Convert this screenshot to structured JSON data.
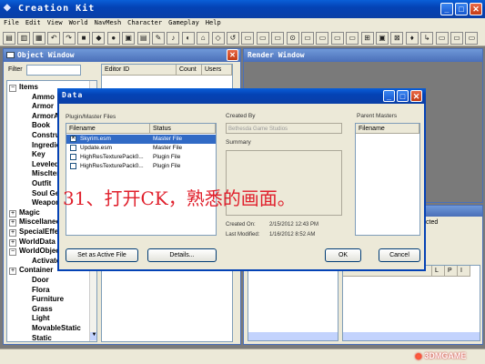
{
  "app": {
    "title": "Creation Kit",
    "menu": [
      "File",
      "Edit",
      "View",
      "World",
      "NavMesh",
      "Character",
      "Gameplay",
      "Help"
    ],
    "colors": {
      "titlebar": "#0442b5",
      "workspace": "#7a7a7a",
      "dialog_bg": "#ece9d8",
      "selection": "#316ac5"
    }
  },
  "object_window": {
    "title": "Object Window",
    "filter_label": "Filter",
    "filter_value": "",
    "columns": [
      "Editor ID",
      "Count",
      "Users"
    ],
    "tree": [
      {
        "label": "Items",
        "expander": "−"
      },
      {
        "label": "Ammo"
      },
      {
        "label": "Armor"
      },
      {
        "label": "ArmorAddon"
      },
      {
        "label": "Book"
      },
      {
        "label": "Constructible"
      },
      {
        "label": "Ingredient"
      },
      {
        "label": "Key"
      },
      {
        "label": "LeveledItem"
      },
      {
        "label": "MiscItem"
      },
      {
        "label": "Outfit"
      },
      {
        "label": "Soul Gem"
      },
      {
        "label": "Weapon"
      },
      {
        "label": "Magic",
        "expander": "+"
      },
      {
        "label": "Miscellaneous",
        "expander": "+"
      },
      {
        "label": "SpecialEffect",
        "expander": "+"
      },
      {
        "label": "WorldData",
        "expander": "+"
      },
      {
        "label": "WorldObjects",
        "expander": "−"
      },
      {
        "label": "Activator"
      },
      {
        "label": "Container",
        "expander": "+"
      },
      {
        "label": "Door"
      },
      {
        "label": "Flora"
      },
      {
        "label": "Furniture"
      },
      {
        "label": "Grass"
      },
      {
        "label": "Light"
      },
      {
        "label": "MovableStatic"
      },
      {
        "label": "Static"
      }
    ]
  },
  "render_window": {
    "title": "Render Window"
  },
  "cell_view": {
    "partial_label": "cted",
    "columns": [
      "L",
      "P",
      "I"
    ]
  },
  "data_dialog": {
    "title": "Data",
    "files_label": "Plugin/Master Files",
    "columns": [
      "Filename",
      "Status"
    ],
    "files": [
      {
        "name": "Skyrim.esm",
        "status": "Master File",
        "checked": true,
        "selected": true
      },
      {
        "name": "Update.esm",
        "status": "Master File",
        "checked": false,
        "selected": false
      },
      {
        "name": "HighResTexturePack0...",
        "status": "Plugin File",
        "checked": false,
        "selected": false
      },
      {
        "name": "HighResTexturePack0...",
        "status": "Plugin File",
        "checked": false,
        "selected": false
      }
    ],
    "created_by_label": "Created By",
    "created_by_value": "Bethesda Game Studios",
    "summary_label": "Summary",
    "parent_masters_label": "Parent Masters",
    "parent_masters_column": "Filename",
    "created_on_label": "Created On:",
    "created_on_value": "2/15/2012  12:43 PM",
    "last_modified_label": "Last Modified:",
    "last_modified_value": "1/16/2012  8:52 AM",
    "buttons": {
      "set_active": "Set as Active File",
      "details": "Details...",
      "ok": "OK",
      "cancel": "Cancel"
    }
  },
  "overlay_caption": "31、打开CK，熟悉的画面。",
  "watermark": "3DMGAME"
}
